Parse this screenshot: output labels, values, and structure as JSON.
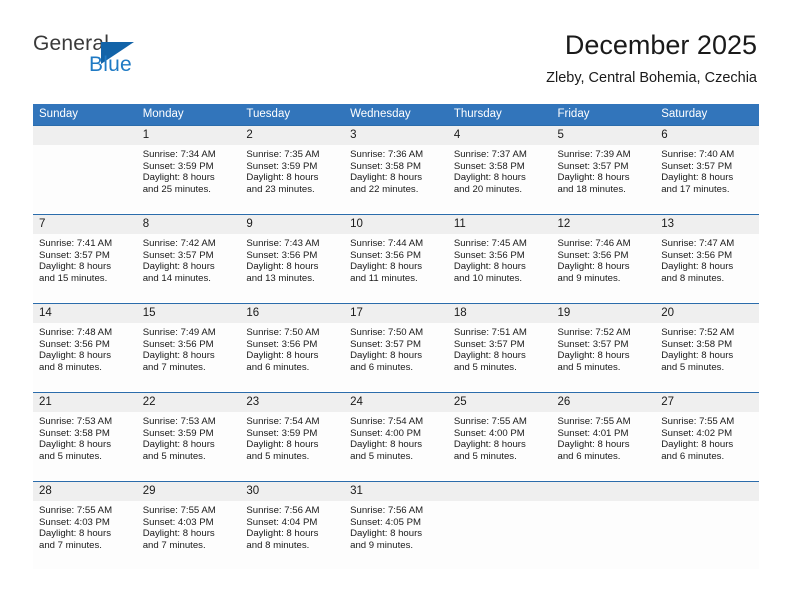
{
  "brand": {
    "name_top": "General",
    "name_bottom": "Blue",
    "triangle_color": "#1263a8",
    "blue_color": "#1f7ac4"
  },
  "header": {
    "title": "December 2025",
    "subtitle": "Zleby, Central Bohemia, Czechia"
  },
  "theme": {
    "header_blue": "#3275bb",
    "row_line_blue": "#2b6cab",
    "daynum_band": "#efefef"
  },
  "weekdays": [
    "Sunday",
    "Monday",
    "Tuesday",
    "Wednesday",
    "Thursday",
    "Friday",
    "Saturday"
  ],
  "weeks": [
    [
      {
        "day": "",
        "l1": "",
        "l2": "",
        "l3": "",
        "l4": ""
      },
      {
        "day": "1",
        "l1": "Sunrise: 7:34 AM",
        "l2": "Sunset: 3:59 PM",
        "l3": "Daylight: 8 hours",
        "l4": "and 25 minutes."
      },
      {
        "day": "2",
        "l1": "Sunrise: 7:35 AM",
        "l2": "Sunset: 3:59 PM",
        "l3": "Daylight: 8 hours",
        "l4": "and 23 minutes."
      },
      {
        "day": "3",
        "l1": "Sunrise: 7:36 AM",
        "l2": "Sunset: 3:58 PM",
        "l3": "Daylight: 8 hours",
        "l4": "and 22 minutes."
      },
      {
        "day": "4",
        "l1": "Sunrise: 7:37 AM",
        "l2": "Sunset: 3:58 PM",
        "l3": "Daylight: 8 hours",
        "l4": "and 20 minutes."
      },
      {
        "day": "5",
        "l1": "Sunrise: 7:39 AM",
        "l2": "Sunset: 3:57 PM",
        "l3": "Daylight: 8 hours",
        "l4": "and 18 minutes."
      },
      {
        "day": "6",
        "l1": "Sunrise: 7:40 AM",
        "l2": "Sunset: 3:57 PM",
        "l3": "Daylight: 8 hours",
        "l4": "and 17 minutes."
      }
    ],
    [
      {
        "day": "7",
        "l1": "Sunrise: 7:41 AM",
        "l2": "Sunset: 3:57 PM",
        "l3": "Daylight: 8 hours",
        "l4": "and 15 minutes."
      },
      {
        "day": "8",
        "l1": "Sunrise: 7:42 AM",
        "l2": "Sunset: 3:57 PM",
        "l3": "Daylight: 8 hours",
        "l4": "and 14 minutes."
      },
      {
        "day": "9",
        "l1": "Sunrise: 7:43 AM",
        "l2": "Sunset: 3:56 PM",
        "l3": "Daylight: 8 hours",
        "l4": "and 13 minutes."
      },
      {
        "day": "10",
        "l1": "Sunrise: 7:44 AM",
        "l2": "Sunset: 3:56 PM",
        "l3": "Daylight: 8 hours",
        "l4": "and 11 minutes."
      },
      {
        "day": "11",
        "l1": "Sunrise: 7:45 AM",
        "l2": "Sunset: 3:56 PM",
        "l3": "Daylight: 8 hours",
        "l4": "and 10 minutes."
      },
      {
        "day": "12",
        "l1": "Sunrise: 7:46 AM",
        "l2": "Sunset: 3:56 PM",
        "l3": "Daylight: 8 hours",
        "l4": "and 9 minutes."
      },
      {
        "day": "13",
        "l1": "Sunrise: 7:47 AM",
        "l2": "Sunset: 3:56 PM",
        "l3": "Daylight: 8 hours",
        "l4": "and 8 minutes."
      }
    ],
    [
      {
        "day": "14",
        "l1": "Sunrise: 7:48 AM",
        "l2": "Sunset: 3:56 PM",
        "l3": "Daylight: 8 hours",
        "l4": "and 8 minutes."
      },
      {
        "day": "15",
        "l1": "Sunrise: 7:49 AM",
        "l2": "Sunset: 3:56 PM",
        "l3": "Daylight: 8 hours",
        "l4": "and 7 minutes."
      },
      {
        "day": "16",
        "l1": "Sunrise: 7:50 AM",
        "l2": "Sunset: 3:56 PM",
        "l3": "Daylight: 8 hours",
        "l4": "and 6 minutes."
      },
      {
        "day": "17",
        "l1": "Sunrise: 7:50 AM",
        "l2": "Sunset: 3:57 PM",
        "l3": "Daylight: 8 hours",
        "l4": "and 6 minutes."
      },
      {
        "day": "18",
        "l1": "Sunrise: 7:51 AM",
        "l2": "Sunset: 3:57 PM",
        "l3": "Daylight: 8 hours",
        "l4": "and 5 minutes."
      },
      {
        "day": "19",
        "l1": "Sunrise: 7:52 AM",
        "l2": "Sunset: 3:57 PM",
        "l3": "Daylight: 8 hours",
        "l4": "and 5 minutes."
      },
      {
        "day": "20",
        "l1": "Sunrise: 7:52 AM",
        "l2": "Sunset: 3:58 PM",
        "l3": "Daylight: 8 hours",
        "l4": "and 5 minutes."
      }
    ],
    [
      {
        "day": "21",
        "l1": "Sunrise: 7:53 AM",
        "l2": "Sunset: 3:58 PM",
        "l3": "Daylight: 8 hours",
        "l4": "and 5 minutes."
      },
      {
        "day": "22",
        "l1": "Sunrise: 7:53 AM",
        "l2": "Sunset: 3:59 PM",
        "l3": "Daylight: 8 hours",
        "l4": "and 5 minutes."
      },
      {
        "day": "23",
        "l1": "Sunrise: 7:54 AM",
        "l2": "Sunset: 3:59 PM",
        "l3": "Daylight: 8 hours",
        "l4": "and 5 minutes."
      },
      {
        "day": "24",
        "l1": "Sunrise: 7:54 AM",
        "l2": "Sunset: 4:00 PM",
        "l3": "Daylight: 8 hours",
        "l4": "and 5 minutes."
      },
      {
        "day": "25",
        "l1": "Sunrise: 7:55 AM",
        "l2": "Sunset: 4:00 PM",
        "l3": "Daylight: 8 hours",
        "l4": "and 5 minutes."
      },
      {
        "day": "26",
        "l1": "Sunrise: 7:55 AM",
        "l2": "Sunset: 4:01 PM",
        "l3": "Daylight: 8 hours",
        "l4": "and 6 minutes."
      },
      {
        "day": "27",
        "l1": "Sunrise: 7:55 AM",
        "l2": "Sunset: 4:02 PM",
        "l3": "Daylight: 8 hours",
        "l4": "and 6 minutes."
      }
    ],
    [
      {
        "day": "28",
        "l1": "Sunrise: 7:55 AM",
        "l2": "Sunset: 4:03 PM",
        "l3": "Daylight: 8 hours",
        "l4": "and 7 minutes."
      },
      {
        "day": "29",
        "l1": "Sunrise: 7:55 AM",
        "l2": "Sunset: 4:03 PM",
        "l3": "Daylight: 8 hours",
        "l4": "and 7 minutes."
      },
      {
        "day": "30",
        "l1": "Sunrise: 7:56 AM",
        "l2": "Sunset: 4:04 PM",
        "l3": "Daylight: 8 hours",
        "l4": "and 8 minutes."
      },
      {
        "day": "31",
        "l1": "Sunrise: 7:56 AM",
        "l2": "Sunset: 4:05 PM",
        "l3": "Daylight: 8 hours",
        "l4": "and 9 minutes."
      },
      {
        "day": "",
        "l1": "",
        "l2": "",
        "l3": "",
        "l4": ""
      },
      {
        "day": "",
        "l1": "",
        "l2": "",
        "l3": "",
        "l4": ""
      },
      {
        "day": "",
        "l1": "",
        "l2": "",
        "l3": "",
        "l4": ""
      }
    ]
  ]
}
